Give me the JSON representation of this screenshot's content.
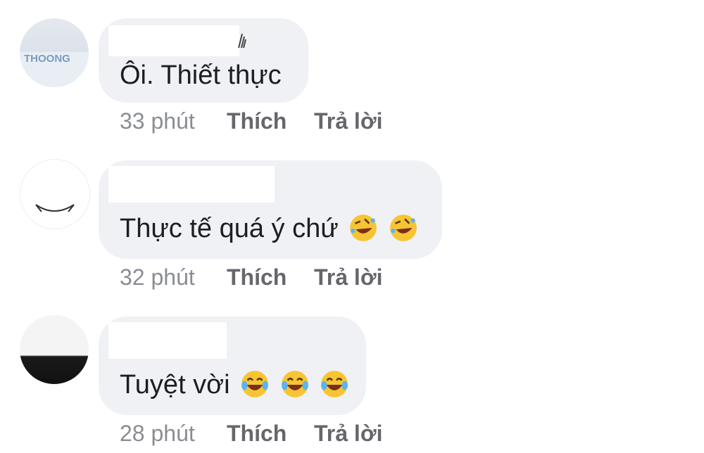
{
  "comments": [
    {
      "text": "Ôi. Thiết thực",
      "time": "33 phút",
      "like_label": "Thích",
      "reply_label": "Trả lời",
      "emojis": [],
      "avatar_text": "THOONG"
    },
    {
      "text": "Thực tế quá ý chứ",
      "time": "32 phút",
      "like_label": "Thích",
      "reply_label": "Trả lời",
      "emojis": [
        "rolling-on-floor-laughing-icon",
        "rolling-on-floor-laughing-icon"
      ]
    },
    {
      "text": "Tuyệt vời",
      "time": "28 phút",
      "like_label": "Thích",
      "reply_label": "Trả lời",
      "emojis": [
        "tears-of-joy-icon",
        "tears-of-joy-icon",
        "tears-of-joy-icon"
      ]
    }
  ],
  "colors": {
    "bubble": "#f0f1f4",
    "text": "#1c1e21",
    "meta": "#8a8d91",
    "emoji_face": "#f7c433"
  }
}
